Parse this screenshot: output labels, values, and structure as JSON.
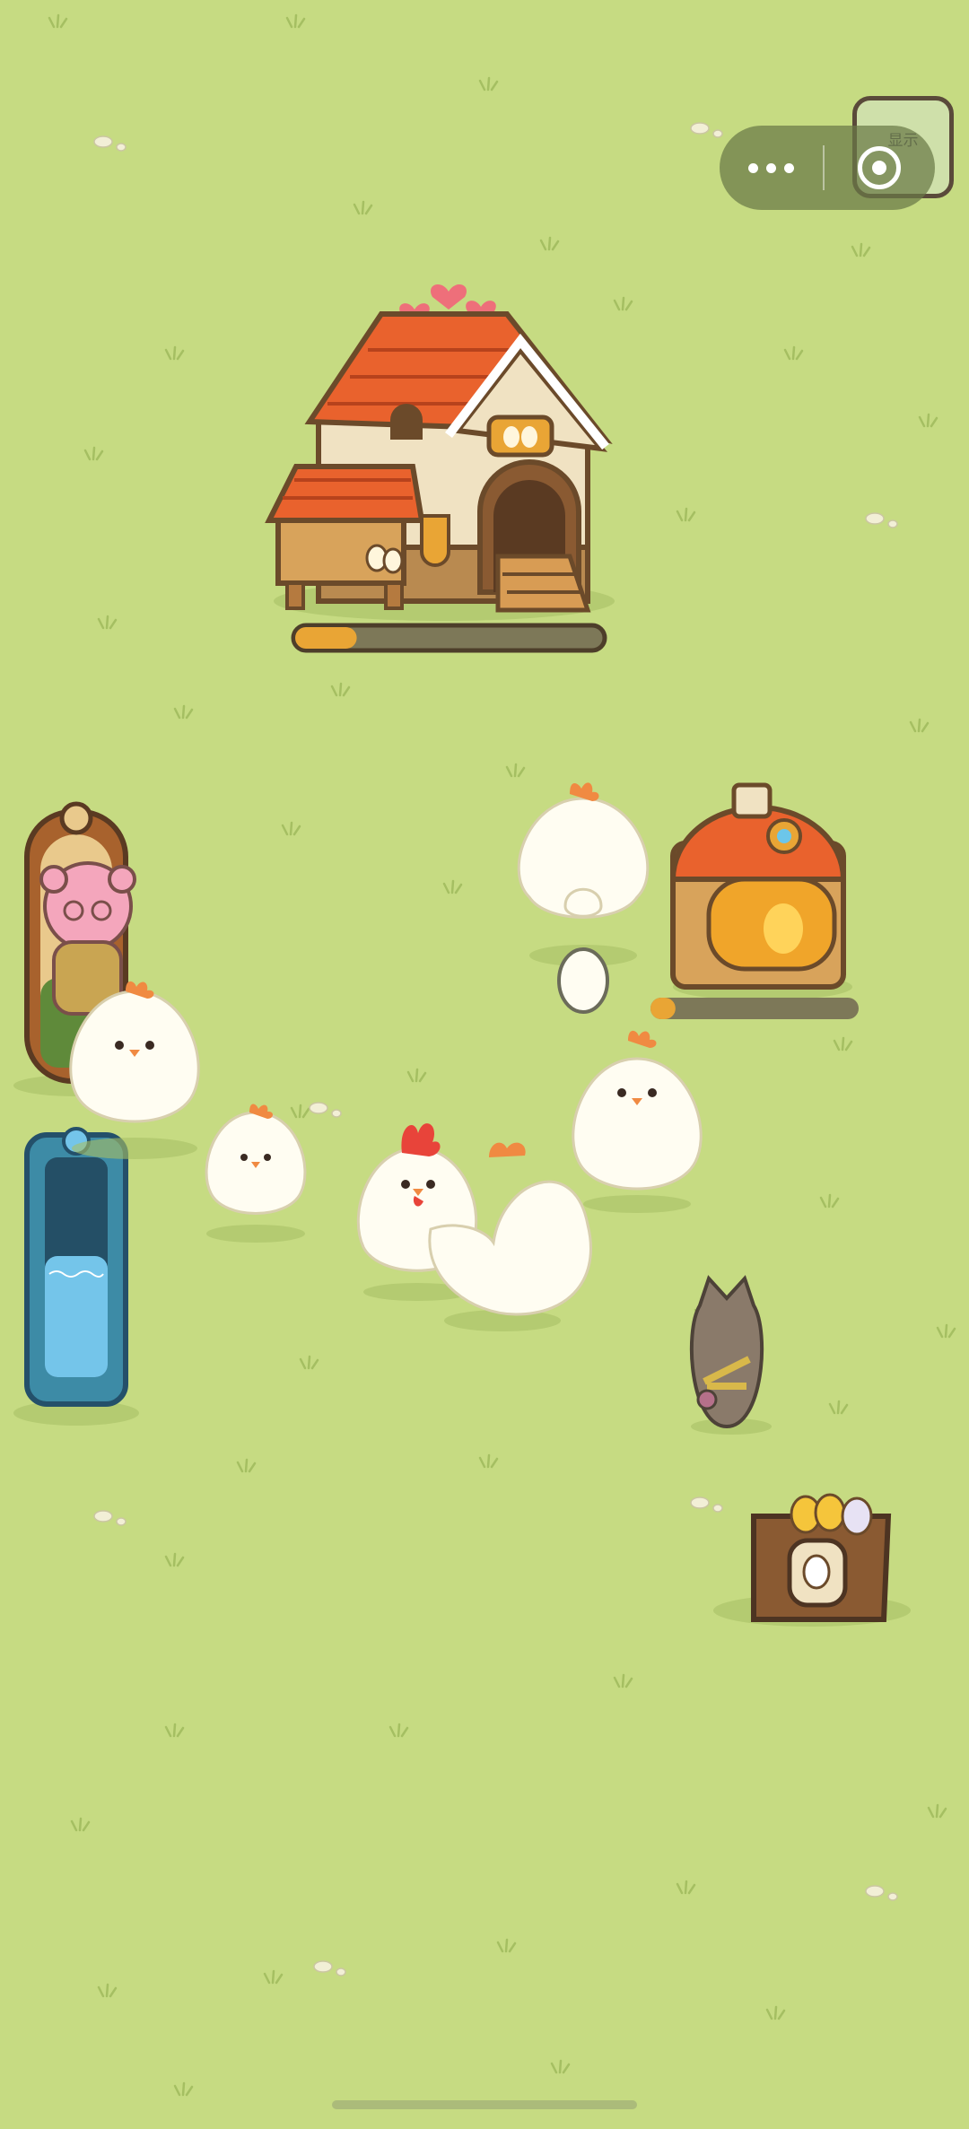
{
  "top_bar": {
    "display_button_label": "显示",
    "more_icon": "three-dots-icon",
    "close_icon": "target-circle-icon",
    "capsule_color": "#6a7846"
  },
  "coop": {
    "progress": 0.2,
    "progress_fill_color": "#e9a535",
    "progress_track_color": "#7d7858"
  },
  "incubator": {
    "progress": 0.12,
    "progress_fill_color": "#e9a535",
    "progress_track_color": "#7d7858"
  },
  "colors": {
    "grass": "#c6db82",
    "roof": "#e9622d",
    "wood": "#d8a35b",
    "chicken": "#fffdf2"
  }
}
